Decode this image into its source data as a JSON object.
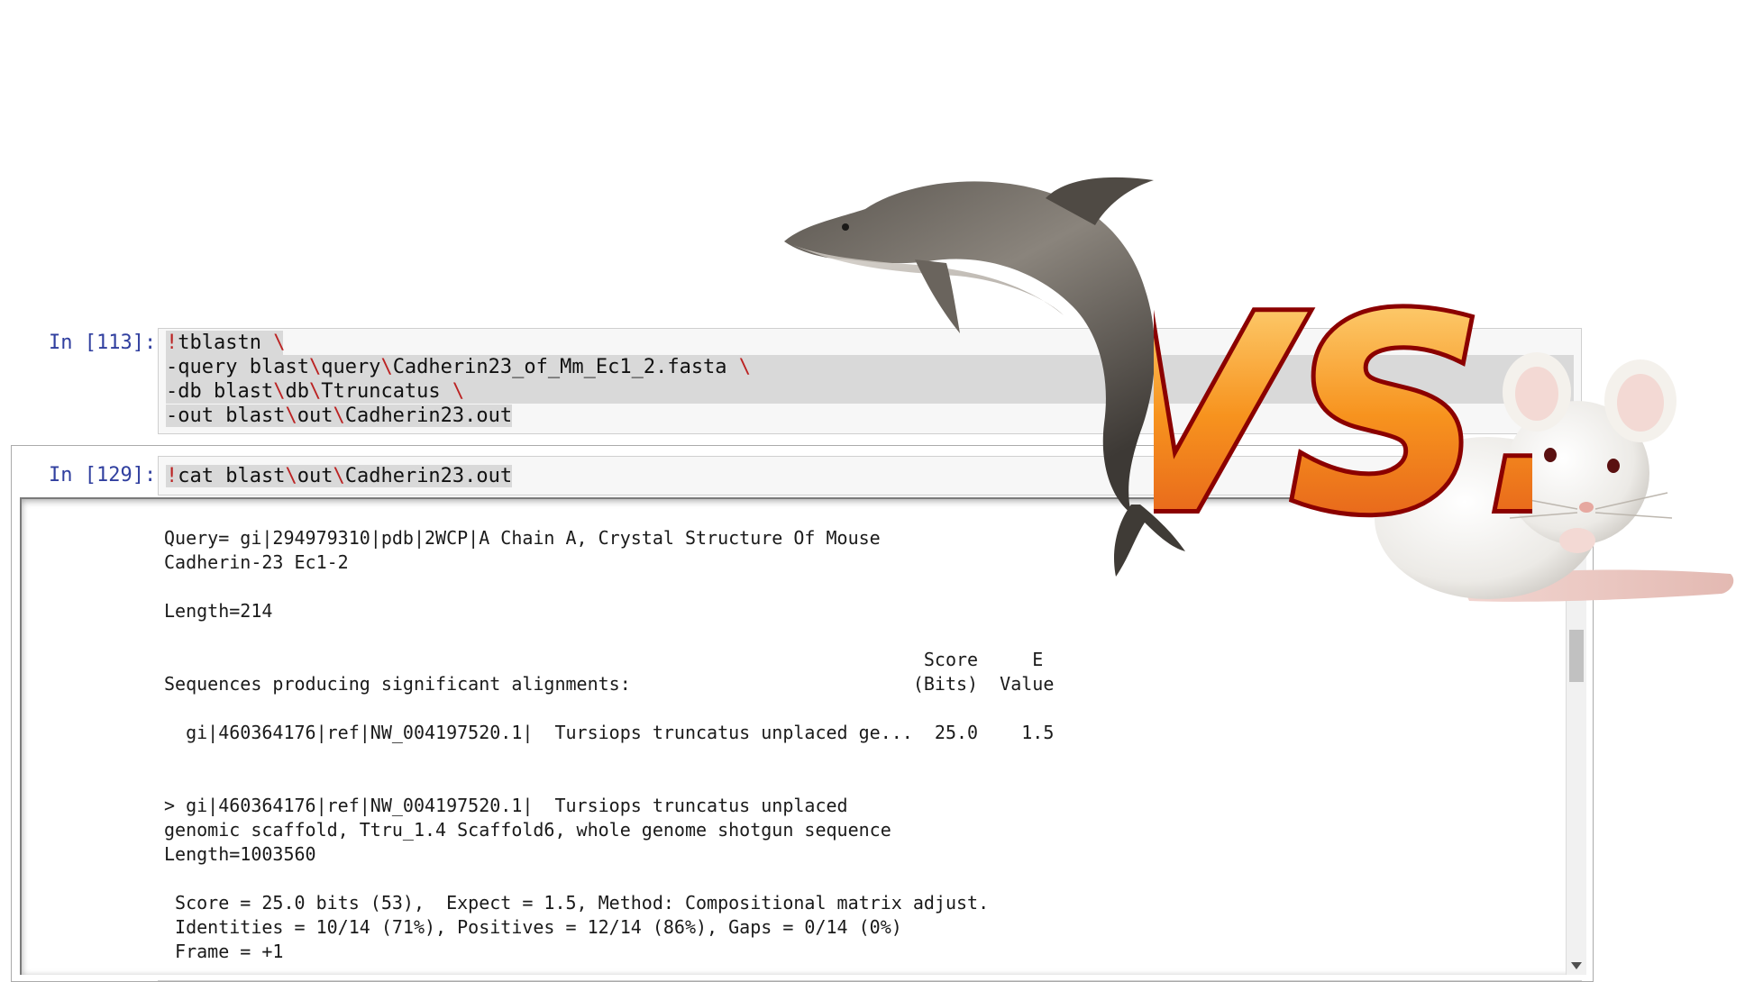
{
  "cell_113": {
    "prompt": "In [113]:",
    "lines": [
      {
        "cmd": "tblastn ",
        "bang": "!",
        "tail": "\\"
      },
      {
        "pre": "-query blast",
        "a": "\\",
        "mid": "query",
        "b": "\\",
        "post": "Cadherin23_of_Mm_Ec1_2.fasta ",
        "c": "\\"
      },
      {
        "pre": "-db blast",
        "a": "\\",
        "mid": "db",
        "b": "\\",
        "post": "Ttruncatus ",
        "c": "\\"
      },
      {
        "pre": "-out blast",
        "a": "\\",
        "mid": "out",
        "b": "\\",
        "post": "Cadherin23.out"
      }
    ]
  },
  "cell_129": {
    "prompt": "In [129]:",
    "command": {
      "bang": "!",
      "pre": "cat blast",
      "a": "\\",
      "mid": "out",
      "b": "\\",
      "post": "Cadherin23.out"
    }
  },
  "output_text": "Query= gi|294979310|pdb|2WCP|A Chain A, Crystal Structure Of Mouse\nCadherin-23 Ec1-2\n\nLength=214\n\n                                                                      Score     E\nSequences producing significant alignments:                          (Bits)  Value\n\n  gi|460364176|ref|NW_004197520.1|  Tursiops truncatus unplaced ge...  25.0    1.5\n\n\n> gi|460364176|ref|NW_004197520.1|  Tursiops truncatus unplaced\ngenomic scaffold, Ttru_1.4 Scaffold6, whole genome shotgun sequence\nLength=1003560\n\n Score = 25.0 bits (53),  Expect = 1.5, Method: Compositional matrix adjust.\n Identities = 10/14 (71%), Positives = 12/14 (86%), Gaps = 0/14 (0%)\n Frame = +1",
  "vs_text": "VS.",
  "icons": [
    "dolphin-illustration",
    "mouse-illustration",
    "vs-graphic"
  ],
  "colors": {
    "prompt": "#303f9f",
    "string_escape": "#b22222",
    "vs_fill": "#f7931e",
    "vs_outline": "#8b0000"
  }
}
